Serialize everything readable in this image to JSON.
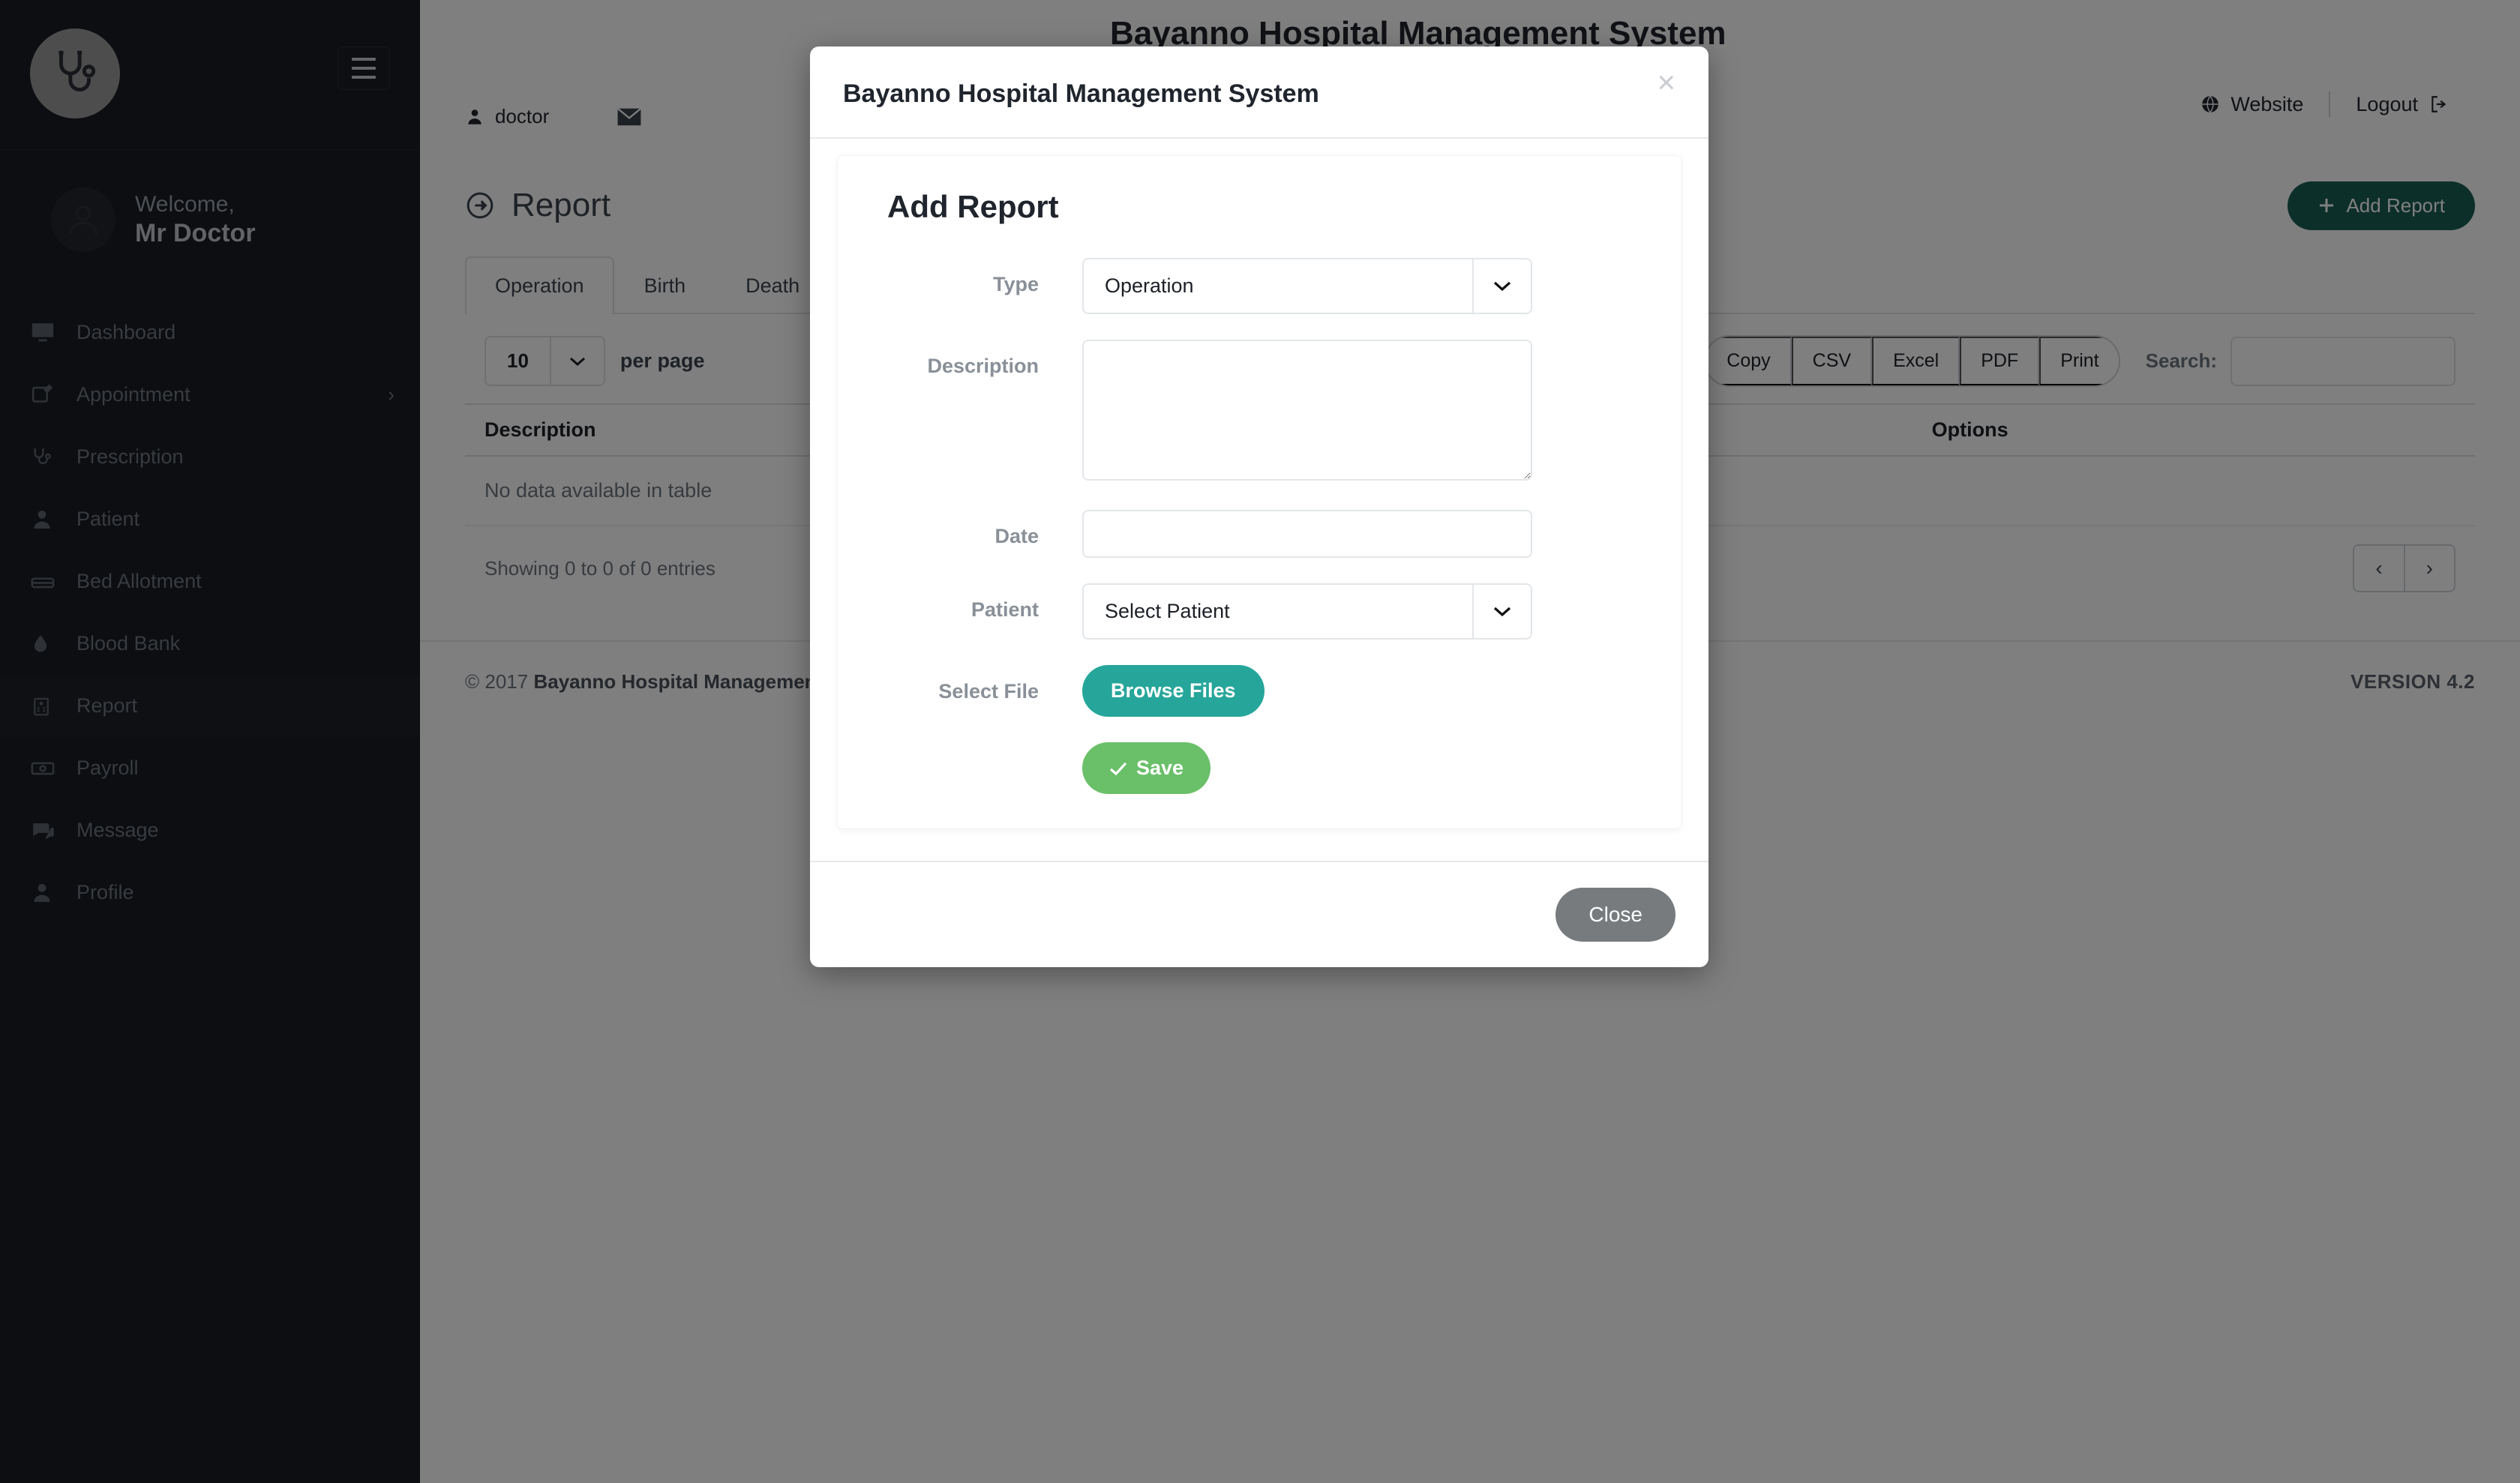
{
  "app": {
    "title": "Bayanno Hospital Management System",
    "version_label": "VERSION 4.2",
    "copyright_prefix": "© 2017 ",
    "copyright_name": "Bayanno Hospital Management System"
  },
  "sidebar": {
    "logo_icon": "stethoscope-icon",
    "menu_toggle_icon": "hamburger-icon",
    "welcome_prefix": "Welcome,",
    "user_name": "Mr Doctor",
    "avatar_icon": "user-avatar-icon",
    "items": [
      {
        "label": "Dashboard",
        "icon": "monitor-icon",
        "active": false,
        "caret": ""
      },
      {
        "label": "Appointment",
        "icon": "edit-note-icon",
        "active": false,
        "caret": "›"
      },
      {
        "label": "Prescription",
        "icon": "stethoscope-icon",
        "active": false,
        "caret": ""
      },
      {
        "label": "Patient",
        "icon": "user-icon",
        "active": false,
        "caret": ""
      },
      {
        "label": "Bed Allotment",
        "icon": "bed-icon",
        "active": false,
        "caret": ""
      },
      {
        "label": "Blood Bank",
        "icon": "blood-drop-icon",
        "active": false,
        "caret": ""
      },
      {
        "label": "Report",
        "icon": "hospital-icon",
        "active": true,
        "caret": ""
      },
      {
        "label": "Payroll",
        "icon": "money-icon",
        "active": false,
        "caret": ""
      },
      {
        "label": "Message",
        "icon": "comments-icon",
        "active": false,
        "caret": ""
      },
      {
        "label": "Profile",
        "icon": "user-icon",
        "active": false,
        "caret": ""
      }
    ]
  },
  "topbar": {
    "user_label": "doctor",
    "user_icon": "user-icon",
    "mail_icon": "envelope-icon",
    "website_label": "Website",
    "website_icon": "globe-icon",
    "logout_label": "Logout",
    "logout_icon": "sign-out-icon"
  },
  "page": {
    "title": "Report",
    "title_icon": "arrow-circle-right-icon",
    "add_button_label": "Add Report",
    "add_button_icon": "plus-icon",
    "add_button_color": "#1a5e55"
  },
  "tabs": [
    {
      "label": "Operation",
      "active": true
    },
    {
      "label": "Birth",
      "active": false
    },
    {
      "label": "Death",
      "active": false
    }
  ],
  "table": {
    "per_page_value": "10",
    "per_page_label": "per page",
    "export_buttons": [
      "Copy",
      "CSV",
      "Excel",
      "PDF",
      "Print"
    ],
    "search_label": "Search:",
    "search_value": "",
    "search_placeholder": "",
    "columns": [
      "Description",
      "Options"
    ],
    "empty_message": "No data available in table",
    "info": "Showing 0 to 0 of 0 entries",
    "pager_prev": "‹",
    "pager_next": "›"
  },
  "modal": {
    "header_title": "Bayanno Hospital Management System",
    "close_icon": "close-icon",
    "form_title": "Add Report",
    "fields": {
      "type_label": "Type",
      "type_value": "Operation",
      "description_label": "Description",
      "description_value": "",
      "description_placeholder": "",
      "date_label": "Date",
      "date_value": "",
      "date_placeholder": "",
      "patient_label": "Patient",
      "patient_value": "Select Patient",
      "select_file_label": "Select File",
      "browse_button_label": "Browse Files",
      "browse_button_color": "#26a69a",
      "save_button_label": "Save",
      "save_button_icon": "check-icon",
      "save_button_color": "#6abf69"
    },
    "footer_close_label": "Close",
    "footer_close_color": "#777b7e"
  }
}
